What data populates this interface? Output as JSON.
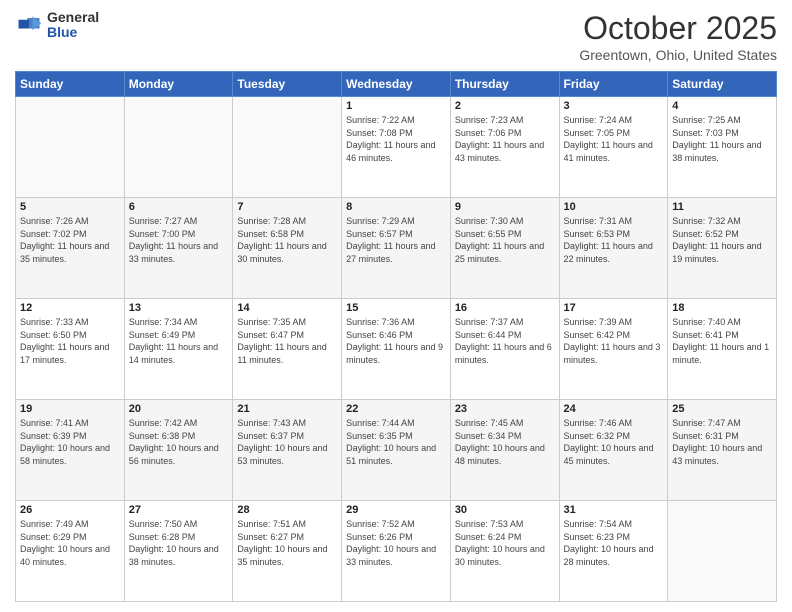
{
  "logo": {
    "general": "General",
    "blue": "Blue"
  },
  "header": {
    "month": "October 2025",
    "location": "Greentown, Ohio, United States"
  },
  "days_of_week": [
    "Sunday",
    "Monday",
    "Tuesday",
    "Wednesday",
    "Thursday",
    "Friday",
    "Saturday"
  ],
  "weeks": [
    [
      {
        "day": "",
        "info": ""
      },
      {
        "day": "",
        "info": ""
      },
      {
        "day": "",
        "info": ""
      },
      {
        "day": "1",
        "info": "Sunrise: 7:22 AM\nSunset: 7:08 PM\nDaylight: 11 hours and 46 minutes."
      },
      {
        "day": "2",
        "info": "Sunrise: 7:23 AM\nSunset: 7:06 PM\nDaylight: 11 hours and 43 minutes."
      },
      {
        "day": "3",
        "info": "Sunrise: 7:24 AM\nSunset: 7:05 PM\nDaylight: 11 hours and 41 minutes."
      },
      {
        "day": "4",
        "info": "Sunrise: 7:25 AM\nSunset: 7:03 PM\nDaylight: 11 hours and 38 minutes."
      }
    ],
    [
      {
        "day": "5",
        "info": "Sunrise: 7:26 AM\nSunset: 7:02 PM\nDaylight: 11 hours and 35 minutes."
      },
      {
        "day": "6",
        "info": "Sunrise: 7:27 AM\nSunset: 7:00 PM\nDaylight: 11 hours and 33 minutes."
      },
      {
        "day": "7",
        "info": "Sunrise: 7:28 AM\nSunset: 6:58 PM\nDaylight: 11 hours and 30 minutes."
      },
      {
        "day": "8",
        "info": "Sunrise: 7:29 AM\nSunset: 6:57 PM\nDaylight: 11 hours and 27 minutes."
      },
      {
        "day": "9",
        "info": "Sunrise: 7:30 AM\nSunset: 6:55 PM\nDaylight: 11 hours and 25 minutes."
      },
      {
        "day": "10",
        "info": "Sunrise: 7:31 AM\nSunset: 6:53 PM\nDaylight: 11 hours and 22 minutes."
      },
      {
        "day": "11",
        "info": "Sunrise: 7:32 AM\nSunset: 6:52 PM\nDaylight: 11 hours and 19 minutes."
      }
    ],
    [
      {
        "day": "12",
        "info": "Sunrise: 7:33 AM\nSunset: 6:50 PM\nDaylight: 11 hours and 17 minutes."
      },
      {
        "day": "13",
        "info": "Sunrise: 7:34 AM\nSunset: 6:49 PM\nDaylight: 11 hours and 14 minutes."
      },
      {
        "day": "14",
        "info": "Sunrise: 7:35 AM\nSunset: 6:47 PM\nDaylight: 11 hours and 11 minutes."
      },
      {
        "day": "15",
        "info": "Sunrise: 7:36 AM\nSunset: 6:46 PM\nDaylight: 11 hours and 9 minutes."
      },
      {
        "day": "16",
        "info": "Sunrise: 7:37 AM\nSunset: 6:44 PM\nDaylight: 11 hours and 6 minutes."
      },
      {
        "day": "17",
        "info": "Sunrise: 7:39 AM\nSunset: 6:42 PM\nDaylight: 11 hours and 3 minutes."
      },
      {
        "day": "18",
        "info": "Sunrise: 7:40 AM\nSunset: 6:41 PM\nDaylight: 11 hours and 1 minute."
      }
    ],
    [
      {
        "day": "19",
        "info": "Sunrise: 7:41 AM\nSunset: 6:39 PM\nDaylight: 10 hours and 58 minutes."
      },
      {
        "day": "20",
        "info": "Sunrise: 7:42 AM\nSunset: 6:38 PM\nDaylight: 10 hours and 56 minutes."
      },
      {
        "day": "21",
        "info": "Sunrise: 7:43 AM\nSunset: 6:37 PM\nDaylight: 10 hours and 53 minutes."
      },
      {
        "day": "22",
        "info": "Sunrise: 7:44 AM\nSunset: 6:35 PM\nDaylight: 10 hours and 51 minutes."
      },
      {
        "day": "23",
        "info": "Sunrise: 7:45 AM\nSunset: 6:34 PM\nDaylight: 10 hours and 48 minutes."
      },
      {
        "day": "24",
        "info": "Sunrise: 7:46 AM\nSunset: 6:32 PM\nDaylight: 10 hours and 45 minutes."
      },
      {
        "day": "25",
        "info": "Sunrise: 7:47 AM\nSunset: 6:31 PM\nDaylight: 10 hours and 43 minutes."
      }
    ],
    [
      {
        "day": "26",
        "info": "Sunrise: 7:49 AM\nSunset: 6:29 PM\nDaylight: 10 hours and 40 minutes."
      },
      {
        "day": "27",
        "info": "Sunrise: 7:50 AM\nSunset: 6:28 PM\nDaylight: 10 hours and 38 minutes."
      },
      {
        "day": "28",
        "info": "Sunrise: 7:51 AM\nSunset: 6:27 PM\nDaylight: 10 hours and 35 minutes."
      },
      {
        "day": "29",
        "info": "Sunrise: 7:52 AM\nSunset: 6:26 PM\nDaylight: 10 hours and 33 minutes."
      },
      {
        "day": "30",
        "info": "Sunrise: 7:53 AM\nSunset: 6:24 PM\nDaylight: 10 hours and 30 minutes."
      },
      {
        "day": "31",
        "info": "Sunrise: 7:54 AM\nSunset: 6:23 PM\nDaylight: 10 hours and 28 minutes."
      },
      {
        "day": "",
        "info": ""
      }
    ]
  ]
}
